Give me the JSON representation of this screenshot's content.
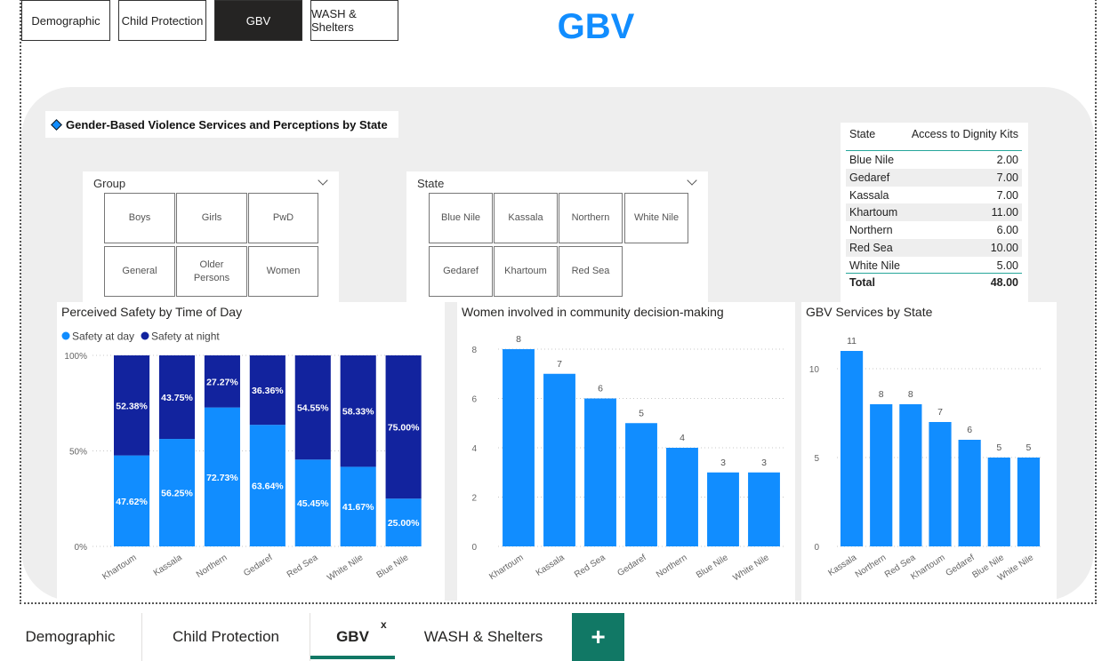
{
  "nav_buttons": [
    "Demographic",
    "Child Protection",
    "GBV",
    "WASH & Shelters"
  ],
  "page_title": "GBV",
  "section_header": "Gender-Based Violence Services and Perceptions by State",
  "group_slicer": {
    "label": "Group",
    "options": [
      "Boys",
      "Girls",
      "PwD",
      "General",
      "Older Persons",
      "Women"
    ]
  },
  "state_slicer": {
    "label": "State",
    "options": [
      "Blue Nile",
      "Kassala",
      "Northern",
      "White Nile",
      "Gedaref",
      "Khartoum",
      "Red Sea"
    ]
  },
  "kits_table": {
    "col_state": "State",
    "col_value": "Access to Dignity Kits",
    "rows": [
      {
        "state": "Blue Nile",
        "value": "2.00"
      },
      {
        "state": "Gedaref",
        "value": "7.00"
      },
      {
        "state": "Kassala",
        "value": "7.00"
      },
      {
        "state": "Khartoum",
        "value": "11.00"
      },
      {
        "state": "Northern",
        "value": "6.00"
      },
      {
        "state": "Red Sea",
        "value": "10.00"
      },
      {
        "state": "White Nile",
        "value": "5.00"
      }
    ],
    "total_label": "Total",
    "total_value": "48.00"
  },
  "colors": {
    "accent": "#118DFF",
    "dark_series": "#12239E",
    "tab_green": "#117865",
    "panel_bg": "#EEEEEE"
  },
  "chart_data": [
    {
      "type": "bar",
      "stacked": "100%",
      "title": "Perceived Safety by Time of Day",
      "legend_position": "top-left",
      "categories": [
        "Khartoum",
        "Kassala",
        "Northern",
        "Gedaref",
        "Red Sea",
        "White Nile",
        "Blue Nile"
      ],
      "series": [
        {
          "name": "Safety at day",
          "values": [
            47.62,
            56.25,
            72.73,
            63.64,
            45.45,
            41.67,
            25.0
          ],
          "labels": [
            "47.62%",
            "56.25%",
            "72.73%",
            "63.64%",
            "45.45%",
            "41.67%",
            "25.00%"
          ]
        },
        {
          "name": "Safety at night",
          "values": [
            52.38,
            43.75,
            27.27,
            36.36,
            54.55,
            58.33,
            75.0
          ],
          "labels": [
            "52.38%",
            "43.75%",
            "27.27%",
            "36.36%",
            "54.55%",
            "58.33%",
            "75.00%"
          ]
        }
      ],
      "y_ticks": [
        "0%",
        "50%",
        "100%"
      ],
      "ylim": [
        0,
        100
      ],
      "grid": true
    },
    {
      "type": "bar",
      "title": "Women involved in community decision-making",
      "categories": [
        "Khartoum",
        "Kassala",
        "Red Sea",
        "Gedaref",
        "Northern",
        "Blue Nile",
        "White Nile"
      ],
      "values": [
        8,
        7,
        6,
        5,
        4,
        3,
        3
      ],
      "y_ticks": [
        "0",
        "2",
        "4",
        "6",
        "8"
      ],
      "ylim": [
        0,
        8
      ],
      "grid": true
    },
    {
      "type": "bar",
      "title": "GBV Services by State",
      "categories": [
        "Kassala",
        "Northern",
        "Red Sea",
        "Khartoum",
        "Gedaref",
        "Blue Nile",
        "White Nile"
      ],
      "values": [
        11,
        8,
        8,
        7,
        6,
        5,
        5
      ],
      "y_ticks": [
        "0",
        "5",
        "10"
      ],
      "ylim": [
        0,
        11
      ],
      "grid": true
    }
  ],
  "bottom_tabs": [
    "Demographic",
    "Child Protection",
    "GBV",
    "WASH & Shelters"
  ],
  "close_glyph": "x",
  "add_glyph": "+"
}
